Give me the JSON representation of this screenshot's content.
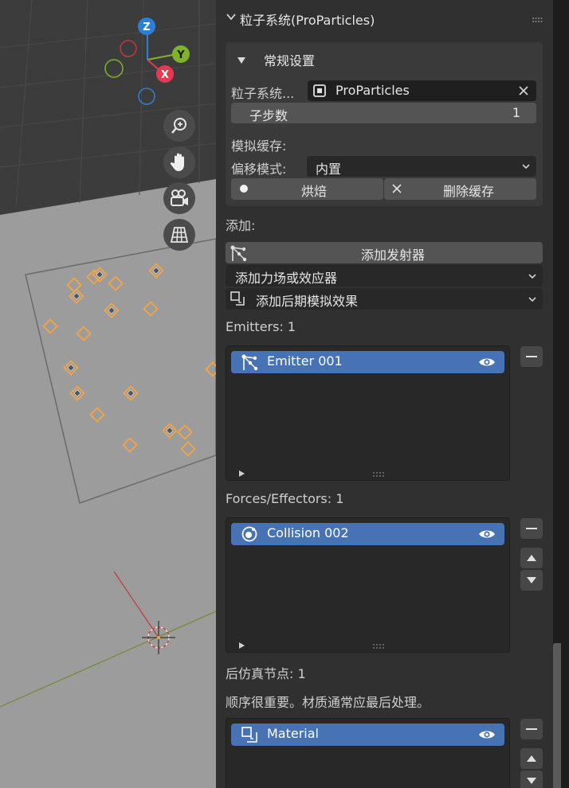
{
  "panel": {
    "header_title": "粒子系统(ProParticles)",
    "general": {
      "title": "常规设置",
      "particle_system_label": "粒子系统...",
      "particle_system_value": "ProParticles",
      "substeps_label": "子步数",
      "substeps_value": "1",
      "sim_cache_label": "模拟缓存:",
      "offset_mode_label": "偏移模式:",
      "offset_mode_value": "内置",
      "bake_label": "烘焙",
      "delete_cache_label": "删除缓存"
    },
    "add": {
      "label": "添加:",
      "add_emitter": "添加发射器",
      "add_force": "添加力场或效应器",
      "add_post": "添加后期模拟效果"
    },
    "emitters": {
      "header": "Emitters: 1",
      "items": [
        "Emitter 001"
      ]
    },
    "forces": {
      "header": "Forces/Effectors: 1",
      "items": [
        "Collision 002"
      ]
    },
    "post": {
      "header": "后仿真节点:  1",
      "note": "顺序很重要。材质通常应最后处理。",
      "items": [
        "Material"
      ]
    }
  },
  "gizmo": {
    "z": "Z",
    "y": "Y",
    "x": "X",
    "colors": {
      "x": "#e8384f",
      "y": "#7fb32a",
      "z": "#2d7fd6"
    }
  },
  "colors": {
    "accent": "#4772b3",
    "selection": "#f5a442"
  }
}
